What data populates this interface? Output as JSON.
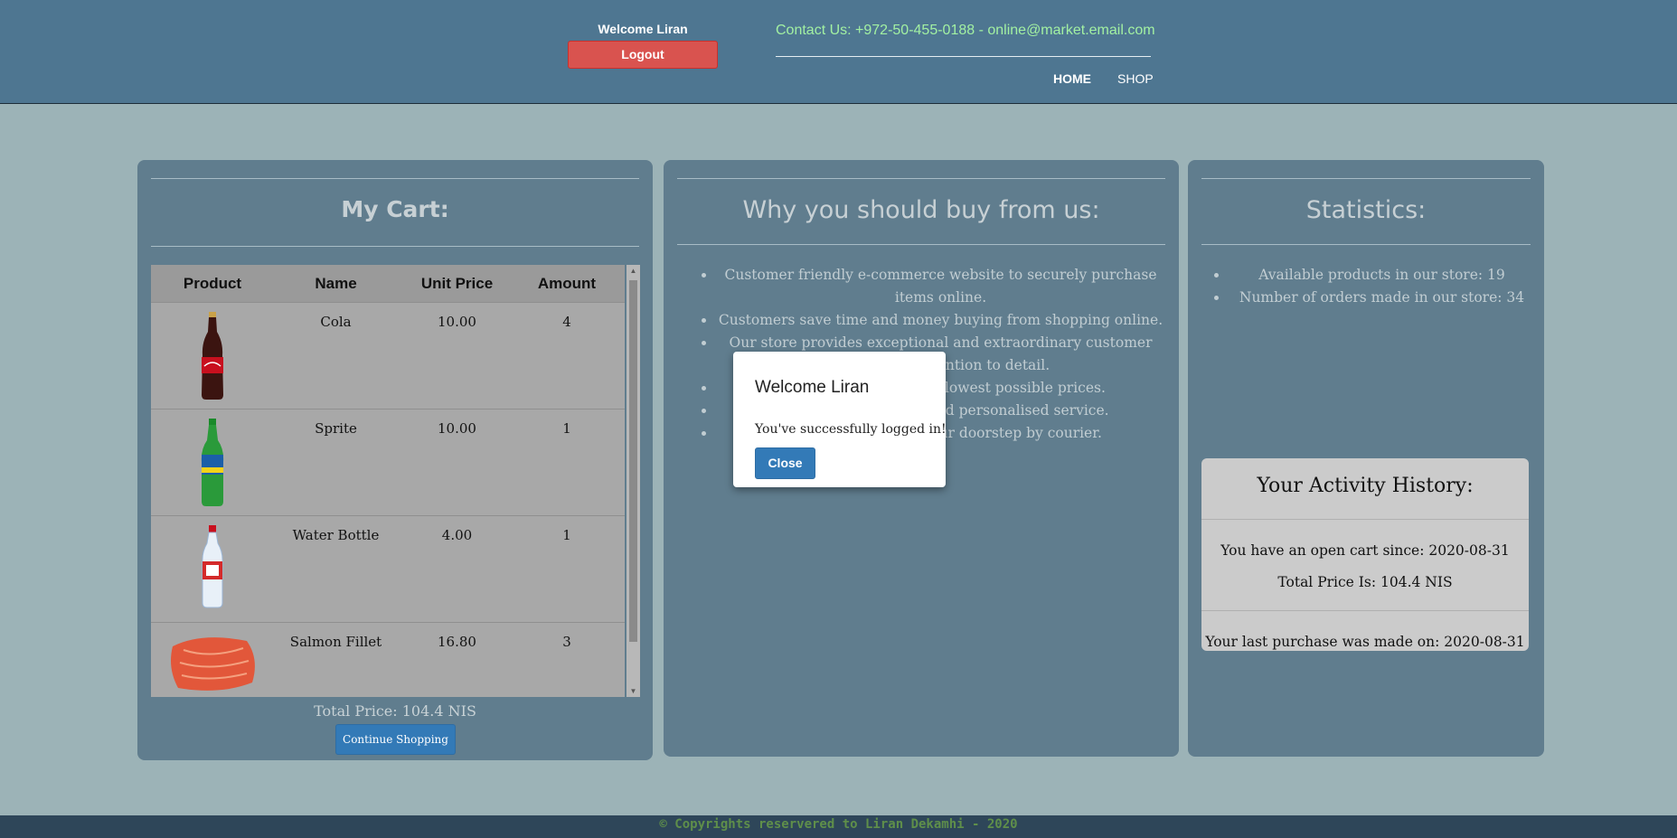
{
  "header": {
    "welcome": "Welcome Liran",
    "logout_label": "Logout",
    "contact": "Contact Us: +972-50-455-0188 - online@market.email.com",
    "nav": {
      "home": "HOME",
      "shop": "SHOP"
    }
  },
  "cart": {
    "title": "My Cart:",
    "columns": [
      "Product",
      "Name",
      "Unit Price",
      "Amount"
    ],
    "items": [
      {
        "name": "Cola",
        "price": "10.00",
        "amount": "4"
      },
      {
        "name": "Sprite",
        "price": "10.00",
        "amount": "1"
      },
      {
        "name": "Water Bottle",
        "price": "4.00",
        "amount": "1"
      },
      {
        "name": "Salmon Fillet",
        "price": "16.80",
        "amount": "3"
      }
    ],
    "total": "Total Price: 104.4 NIS",
    "continue_label": "Continue Shopping"
  },
  "why": {
    "title": "Why you should buy from us:",
    "points": [
      "Customer friendly e-commerce website to securely purchase items online.",
      "Customers save time and money buying from shopping online.",
      "Our store provides exceptional and extraordinary customer service and attention to detail.",
      "Quality products at the lowest possible prices.",
      "Professional, friendly and personalised service.",
      "Orders delivered to your doorstep by courier."
    ]
  },
  "stats": {
    "title": "Statistics:",
    "items": [
      "Available products in our store: 19",
      "Number of orders made in our store: 34"
    ],
    "activity": {
      "title": "Your Activity History:",
      "open_cart": "You have an open cart since: 2020-08-31",
      "total": "Total Price Is: 104.4 NIS",
      "last_purchase": "Your last purchase was made on: 2020-08-31"
    }
  },
  "modal": {
    "title": "Welcome Liran",
    "body": "You've successfully logged in!",
    "close_label": "Close"
  },
  "footer": {
    "text": "© Copyrights reservered to Liran Dekamhi - 2020"
  }
}
